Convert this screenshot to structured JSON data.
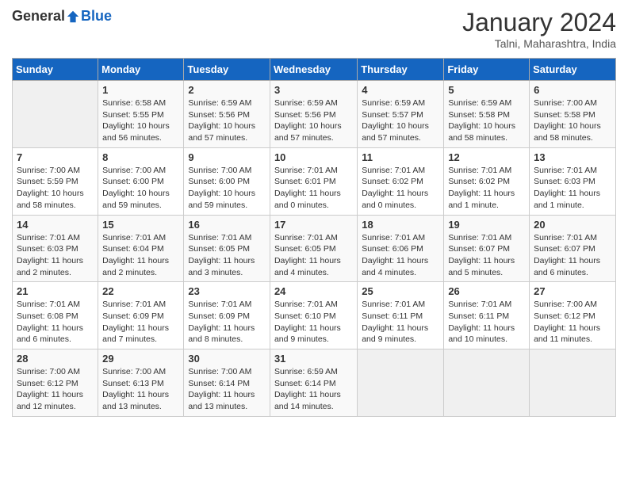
{
  "header": {
    "logo_general": "General",
    "logo_blue": "Blue",
    "title": "January 2024",
    "location": "Talni, Maharashtra, India"
  },
  "days_of_week": [
    "Sunday",
    "Monday",
    "Tuesday",
    "Wednesday",
    "Thursday",
    "Friday",
    "Saturday"
  ],
  "weeks": [
    [
      {
        "day": "",
        "info": ""
      },
      {
        "day": "1",
        "info": "Sunrise: 6:58 AM\nSunset: 5:55 PM\nDaylight: 10 hours\nand 56 minutes."
      },
      {
        "day": "2",
        "info": "Sunrise: 6:59 AM\nSunset: 5:56 PM\nDaylight: 10 hours\nand 57 minutes."
      },
      {
        "day": "3",
        "info": "Sunrise: 6:59 AM\nSunset: 5:56 PM\nDaylight: 10 hours\nand 57 minutes."
      },
      {
        "day": "4",
        "info": "Sunrise: 6:59 AM\nSunset: 5:57 PM\nDaylight: 10 hours\nand 57 minutes."
      },
      {
        "day": "5",
        "info": "Sunrise: 6:59 AM\nSunset: 5:58 PM\nDaylight: 10 hours\nand 58 minutes."
      },
      {
        "day": "6",
        "info": "Sunrise: 7:00 AM\nSunset: 5:58 PM\nDaylight: 10 hours\nand 58 minutes."
      }
    ],
    [
      {
        "day": "7",
        "info": "Sunrise: 7:00 AM\nSunset: 5:59 PM\nDaylight: 10 hours\nand 58 minutes."
      },
      {
        "day": "8",
        "info": "Sunrise: 7:00 AM\nSunset: 6:00 PM\nDaylight: 10 hours\nand 59 minutes."
      },
      {
        "day": "9",
        "info": "Sunrise: 7:00 AM\nSunset: 6:00 PM\nDaylight: 10 hours\nand 59 minutes."
      },
      {
        "day": "10",
        "info": "Sunrise: 7:01 AM\nSunset: 6:01 PM\nDaylight: 11 hours\nand 0 minutes."
      },
      {
        "day": "11",
        "info": "Sunrise: 7:01 AM\nSunset: 6:02 PM\nDaylight: 11 hours\nand 0 minutes."
      },
      {
        "day": "12",
        "info": "Sunrise: 7:01 AM\nSunset: 6:02 PM\nDaylight: 11 hours\nand 1 minute."
      },
      {
        "day": "13",
        "info": "Sunrise: 7:01 AM\nSunset: 6:03 PM\nDaylight: 11 hours\nand 1 minute."
      }
    ],
    [
      {
        "day": "14",
        "info": "Sunrise: 7:01 AM\nSunset: 6:03 PM\nDaylight: 11 hours\nand 2 minutes."
      },
      {
        "day": "15",
        "info": "Sunrise: 7:01 AM\nSunset: 6:04 PM\nDaylight: 11 hours\nand 2 minutes."
      },
      {
        "day": "16",
        "info": "Sunrise: 7:01 AM\nSunset: 6:05 PM\nDaylight: 11 hours\nand 3 minutes."
      },
      {
        "day": "17",
        "info": "Sunrise: 7:01 AM\nSunset: 6:05 PM\nDaylight: 11 hours\nand 4 minutes."
      },
      {
        "day": "18",
        "info": "Sunrise: 7:01 AM\nSunset: 6:06 PM\nDaylight: 11 hours\nand 4 minutes."
      },
      {
        "day": "19",
        "info": "Sunrise: 7:01 AM\nSunset: 6:07 PM\nDaylight: 11 hours\nand 5 minutes."
      },
      {
        "day": "20",
        "info": "Sunrise: 7:01 AM\nSunset: 6:07 PM\nDaylight: 11 hours\nand 6 minutes."
      }
    ],
    [
      {
        "day": "21",
        "info": "Sunrise: 7:01 AM\nSunset: 6:08 PM\nDaylight: 11 hours\nand 6 minutes."
      },
      {
        "day": "22",
        "info": "Sunrise: 7:01 AM\nSunset: 6:09 PM\nDaylight: 11 hours\nand 7 minutes."
      },
      {
        "day": "23",
        "info": "Sunrise: 7:01 AM\nSunset: 6:09 PM\nDaylight: 11 hours\nand 8 minutes."
      },
      {
        "day": "24",
        "info": "Sunrise: 7:01 AM\nSunset: 6:10 PM\nDaylight: 11 hours\nand 9 minutes."
      },
      {
        "day": "25",
        "info": "Sunrise: 7:01 AM\nSunset: 6:11 PM\nDaylight: 11 hours\nand 9 minutes."
      },
      {
        "day": "26",
        "info": "Sunrise: 7:01 AM\nSunset: 6:11 PM\nDaylight: 11 hours\nand 10 minutes."
      },
      {
        "day": "27",
        "info": "Sunrise: 7:00 AM\nSunset: 6:12 PM\nDaylight: 11 hours\nand 11 minutes."
      }
    ],
    [
      {
        "day": "28",
        "info": "Sunrise: 7:00 AM\nSunset: 6:12 PM\nDaylight: 11 hours\nand 12 minutes."
      },
      {
        "day": "29",
        "info": "Sunrise: 7:00 AM\nSunset: 6:13 PM\nDaylight: 11 hours\nand 13 minutes."
      },
      {
        "day": "30",
        "info": "Sunrise: 7:00 AM\nSunset: 6:14 PM\nDaylight: 11 hours\nand 13 minutes."
      },
      {
        "day": "31",
        "info": "Sunrise: 6:59 AM\nSunset: 6:14 PM\nDaylight: 11 hours\nand 14 minutes."
      },
      {
        "day": "",
        "info": ""
      },
      {
        "day": "",
        "info": ""
      },
      {
        "day": "",
        "info": ""
      }
    ]
  ]
}
